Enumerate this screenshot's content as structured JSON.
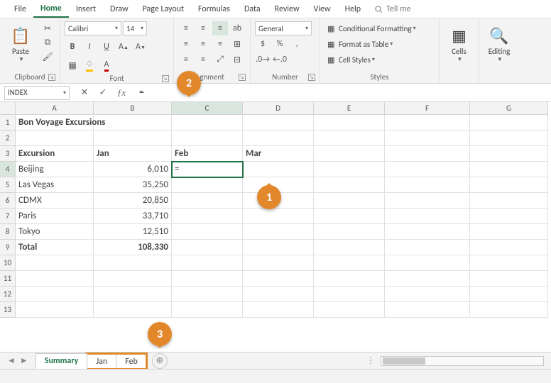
{
  "tabs": {
    "file": "File",
    "home": "Home",
    "insert": "Insert",
    "draw": "Draw",
    "page_layout": "Page Layout",
    "formulas": "Formulas",
    "data": "Data",
    "review": "Review",
    "view": "View",
    "help": "Help",
    "tell_me": "Tell me"
  },
  "ribbon": {
    "clipboard": {
      "label": "Clipboard",
      "paste": "Paste"
    },
    "font": {
      "label": "Font",
      "name": "Calibri",
      "size": "14",
      "bold": "B",
      "italic": "I",
      "underline": "U"
    },
    "alignment": {
      "label": "gnment"
    },
    "number": {
      "label": "Number",
      "format": "General"
    },
    "styles": {
      "label": "Styles",
      "cond": "Conditional Formatting",
      "table": "Format as Table",
      "cell": "Cell Styles"
    },
    "cells": {
      "label": "Cells"
    },
    "editing": {
      "label": "Editing"
    }
  },
  "namebox": "INDEX",
  "formula": "=",
  "columns": [
    "A",
    "B",
    "C",
    "D",
    "E",
    "F",
    "G"
  ],
  "sheet": {
    "title": "Bon Voyage Excursions",
    "headers": {
      "excursion": "Excursion",
      "jan": "Jan",
      "feb": "Feb",
      "mar": "Mar"
    },
    "rows": [
      {
        "name": "Beijing",
        "jan": "6,010"
      },
      {
        "name": "Las Vegas",
        "jan": "35,250"
      },
      {
        "name": "CDMX",
        "jan": "20,850"
      },
      {
        "name": "Paris",
        "jan": "33,710"
      },
      {
        "name": "Tokyo",
        "jan": "12,510"
      }
    ],
    "total": {
      "label": "Total",
      "jan": "108,330"
    },
    "active_cell_value": "="
  },
  "sheet_tabs": {
    "summary": "Summary",
    "jan": "Jan",
    "feb": "Feb"
  },
  "callouts": {
    "one": "1",
    "two": "2",
    "three": "3"
  },
  "chart_data": {
    "type": "table",
    "title": "Bon Voyage Excursions",
    "columns": [
      "Excursion",
      "Jan",
      "Feb",
      "Mar"
    ],
    "rows": [
      [
        "Beijing",
        6010,
        null,
        null
      ],
      [
        "Las Vegas",
        35250,
        null,
        null
      ],
      [
        "CDMX",
        20850,
        null,
        null
      ],
      [
        "Paris",
        33710,
        null,
        null
      ],
      [
        "Tokyo",
        12510,
        null,
        null
      ],
      [
        "Total",
        108330,
        null,
        null
      ]
    ]
  }
}
